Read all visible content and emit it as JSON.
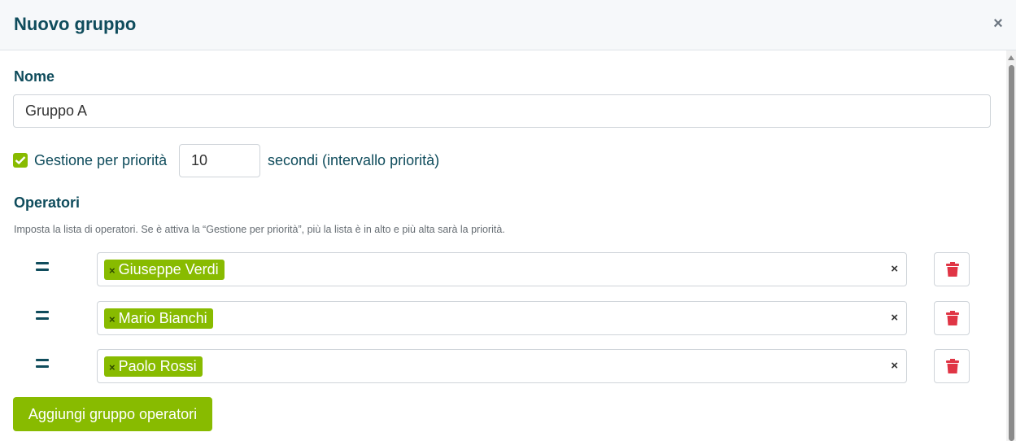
{
  "header": {
    "title": "Nuovo gruppo",
    "close_label": "×"
  },
  "form": {
    "name_label": "Nome",
    "name_value": "Gruppo A",
    "priority_checked": true,
    "priority_label": "Gestione per priorità",
    "priority_seconds": "10",
    "seconds_label": "secondi (intervallo priorità)"
  },
  "operators": {
    "label": "Operatori",
    "help": "Imposta la lista di operatori. Se è attiva la “Gestione per priorità”, più la lista è in alto e più alta sarà la priorità.",
    "tag_remove": "×",
    "clear": "×",
    "rows": [
      {
        "name": "Giuseppe Verdi"
      },
      {
        "name": "Mario Bianchi"
      },
      {
        "name": "Paolo Rossi"
      }
    ]
  },
  "actions": {
    "add_label": "Aggiungi gruppo operatori"
  },
  "colors": {
    "accent": "#88bb00",
    "title": "#0f4c5c",
    "danger": "#e03545"
  }
}
